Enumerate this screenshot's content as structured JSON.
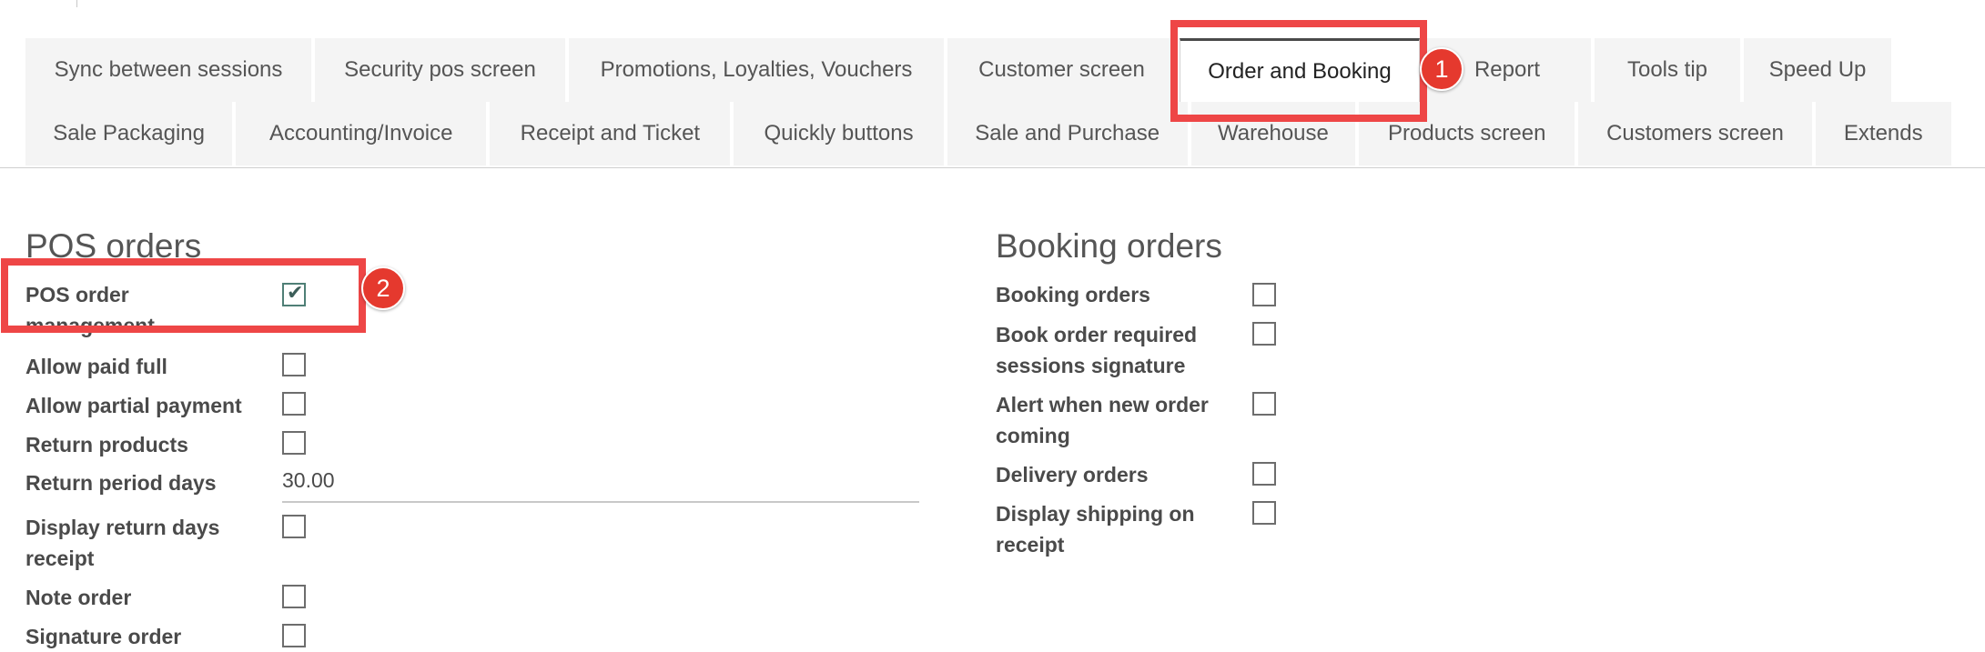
{
  "tabs": {
    "row1": [
      {
        "label": "Sync between sessions",
        "active": false
      },
      {
        "label": "Security pos screen",
        "active": false
      },
      {
        "label": "Promotions, Loyalties, Vouchers",
        "active": false
      },
      {
        "label": "Customer screen",
        "active": false
      },
      {
        "label": "Order and Booking",
        "active": true
      },
      {
        "label": "Report",
        "active": false
      },
      {
        "label": "Tools tip",
        "active": false
      },
      {
        "label": "Speed Up",
        "active": false
      }
    ],
    "row2": [
      {
        "label": "Sale Packaging"
      },
      {
        "label": "Accounting/Invoice"
      },
      {
        "label": "Receipt and Ticket"
      },
      {
        "label": "Quickly buttons"
      },
      {
        "label": "Sale and Purchase"
      },
      {
        "label": "Warehouse"
      },
      {
        "label": "Products screen"
      },
      {
        "label": "Customers screen"
      },
      {
        "label": "Extends"
      }
    ]
  },
  "pos_orders": {
    "title": "POS orders",
    "fields": [
      {
        "label": "POS order management",
        "checked": true
      },
      {
        "label": "Allow paid full",
        "checked": false
      },
      {
        "label": "Allow partial payment",
        "checked": false
      },
      {
        "label": "Return products",
        "checked": false
      },
      {
        "label": "Return period days",
        "value": "30.00"
      },
      {
        "label": "Display return days receipt",
        "checked": false
      },
      {
        "label": "Note order",
        "checked": false
      },
      {
        "label": "Signature order",
        "checked": false
      }
    ]
  },
  "booking_orders": {
    "title": "Booking orders",
    "fields": [
      {
        "label": "Booking orders",
        "checked": false
      },
      {
        "label": "Book order required sessions signature",
        "checked": false
      },
      {
        "label": "Alert when new order coming",
        "checked": false
      },
      {
        "label": "Delivery orders",
        "checked": false
      },
      {
        "label": "Display shipping on receipt",
        "checked": false
      }
    ]
  },
  "annotations": [
    {
      "number": "1"
    },
    {
      "number": "2"
    }
  ],
  "colors": {
    "highlight": "#ee4646",
    "marker": "#e5392e",
    "checkbox_checked": "#4f7f76"
  }
}
